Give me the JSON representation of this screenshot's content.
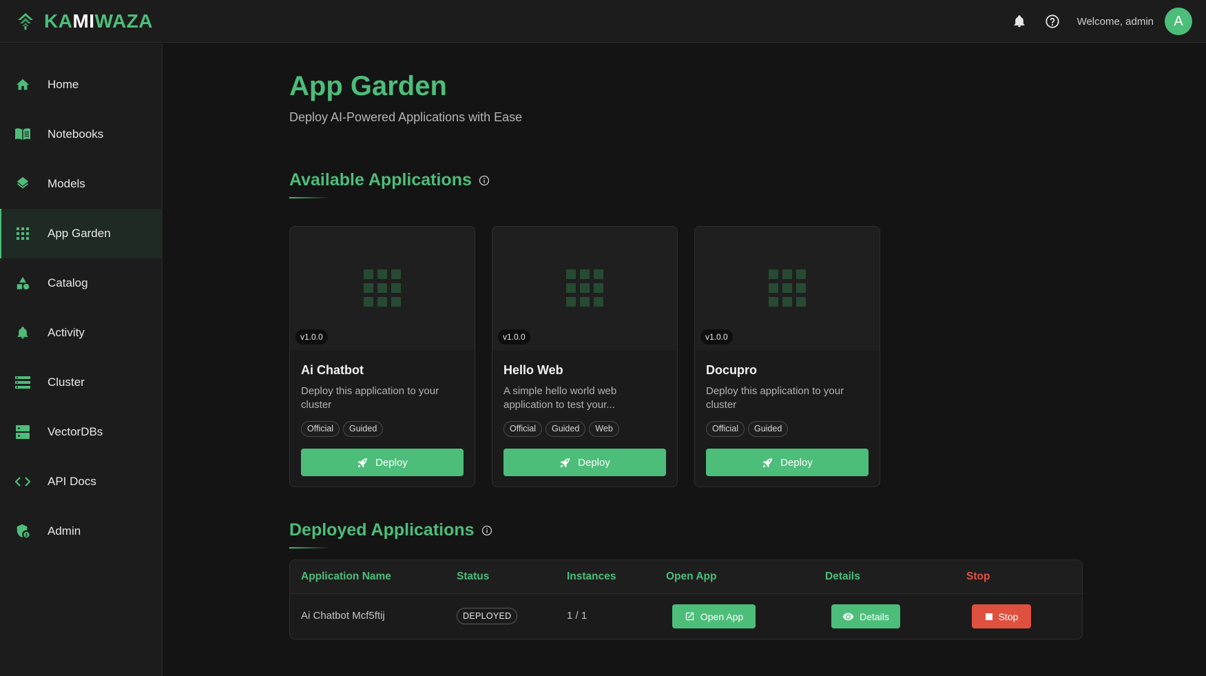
{
  "header": {
    "logo_text_a": "KA",
    "logo_text_b": "MI",
    "logo_text_c": "WAZA",
    "welcome": "Welcome, admin",
    "avatar_letter": "A",
    "icons": [
      "bell-icon",
      "help-icon"
    ]
  },
  "sidebar": {
    "items": [
      {
        "label": "Home",
        "icon": "home-icon"
      },
      {
        "label": "Notebooks",
        "icon": "book-icon"
      },
      {
        "label": "Models",
        "icon": "layers-icon"
      },
      {
        "label": "App Garden",
        "icon": "apps-grid-icon",
        "active": true
      },
      {
        "label": "Catalog",
        "icon": "shapes-icon"
      },
      {
        "label": "Activity",
        "icon": "bell-icon"
      },
      {
        "label": "Cluster",
        "icon": "server-list-icon"
      },
      {
        "label": "VectorDBs",
        "icon": "database-icon"
      },
      {
        "label": "API Docs",
        "icon": "code-icon"
      },
      {
        "label": "Admin",
        "icon": "admin-shield-icon"
      }
    ]
  },
  "page": {
    "title": "App Garden",
    "subtitle": "Deploy AI-Powered Applications with Ease"
  },
  "available": {
    "title": "Available Applications",
    "cards": [
      {
        "version": "v1.0.0",
        "name": "Ai Chatbot",
        "description": "Deploy this application to your cluster",
        "tags": [
          "Official",
          "Guided"
        ],
        "button": "Deploy"
      },
      {
        "version": "v1.0.0",
        "name": "Hello Web",
        "description": "A simple hello world web application to test your...",
        "tags": [
          "Official",
          "Guided",
          "Web"
        ],
        "button": "Deploy"
      },
      {
        "version": "v1.0.0",
        "name": "Docupro",
        "description": "Deploy this application to your cluster",
        "tags": [
          "Official",
          "Guided"
        ],
        "button": "Deploy"
      }
    ]
  },
  "deployed": {
    "title": "Deployed Applications",
    "columns": [
      "Application Name",
      "Status",
      "Instances",
      "Open App",
      "Details",
      "Stop"
    ],
    "rows": [
      {
        "name": "Ai Chatbot Mcf5ftij",
        "status": "DEPLOYED",
        "instances": "1 / 1",
        "open_label": "Open App",
        "details_label": "Details",
        "stop_label": "Stop"
      }
    ]
  },
  "colors": {
    "accent": "#4dbd7a",
    "danger": "#e0503f",
    "background": "#141414",
    "panel": "#1c1c1c"
  }
}
